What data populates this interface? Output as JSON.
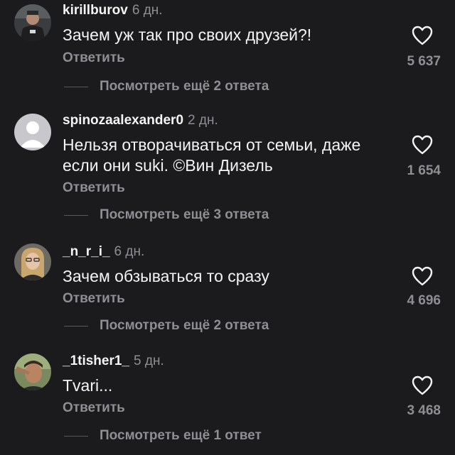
{
  "comments": [
    {
      "username": "kirillburov",
      "age": "6 дн.",
      "text": "Зачем уж так про своих друзей?!",
      "reply_label": "Ответить",
      "likes": "5 637",
      "more_label": "Посмотреть ещё 2 ответа"
    },
    {
      "username": "spinozaalexander0",
      "age": "2 дн.",
      "text": "Нельзя отворачиваться от семьи, даже если они suki. ©Вин Дизель",
      "reply_label": "Ответить",
      "likes": "1 654",
      "more_label": "Посмотреть ещё 3 ответа"
    },
    {
      "username": "_n_r_i_",
      "age": "6 дн.",
      "text": "Зачем обзываться то сразу",
      "reply_label": "Ответить",
      "likes": "4 696",
      "more_label": "Посмотреть ещё 2 ответа"
    },
    {
      "username": "_1tisher1_",
      "age": "5 дн.",
      "text": "Tvari...",
      "reply_label": "Ответить",
      "likes": "3 468",
      "more_label": "Посмотреть ещё 1 ответ"
    }
  ],
  "colors": {
    "background": "#1b1b1d",
    "primary_text": "#f4f4f4",
    "secondary_text": "#8e8e93"
  },
  "icons": {
    "like": "heart-outline-icon",
    "default_avatar": "default-user-avatar-icon"
  }
}
